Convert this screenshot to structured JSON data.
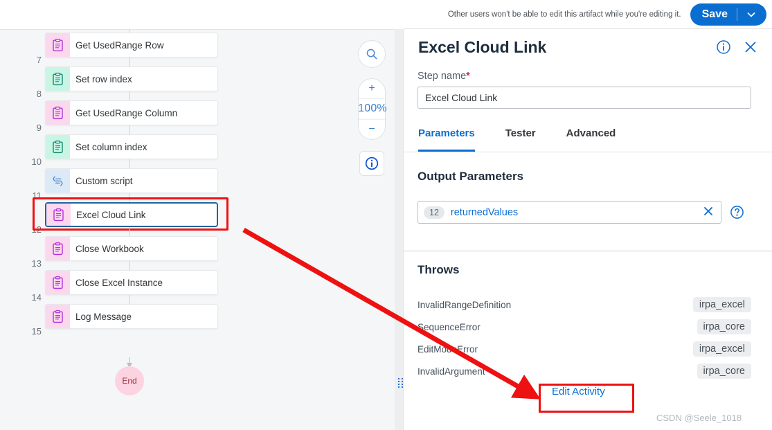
{
  "canvas": {
    "steps": [
      {
        "num": "7",
        "label": "Get UsedRange Row",
        "icon": "clipboard-icon",
        "tint": "pink",
        "selected": false
      },
      {
        "num": "8",
        "label": "Set row index",
        "icon": "clipboard-icon",
        "tint": "mint",
        "selected": false
      },
      {
        "num": "9",
        "label": "Get UsedRange Column",
        "icon": "clipboard-icon",
        "tint": "pink",
        "selected": false
      },
      {
        "num": "10",
        "label": "Set column index",
        "icon": "clipboard-icon",
        "tint": "mint",
        "selected": false
      },
      {
        "num": "11",
        "label": "Custom script",
        "icon": "script-icon",
        "tint": "blue",
        "selected": false
      },
      {
        "num": "12",
        "label": "Excel Cloud Link",
        "icon": "clipboard-icon",
        "tint": "pink",
        "selected": true
      },
      {
        "num": "13",
        "label": "Close Workbook",
        "icon": "clipboard-icon",
        "tint": "pink",
        "selected": false
      },
      {
        "num": "14",
        "label": "Close Excel Instance",
        "icon": "clipboard-icon",
        "tint": "pink",
        "selected": false
      },
      {
        "num": "15",
        "label": "Log Message",
        "icon": "clipboard-icon",
        "tint": "pink",
        "selected": false
      }
    ],
    "end_node_label": "End",
    "controls": {
      "search_icon": "search-icon",
      "zoom_in": "+",
      "zoom_level": "100%",
      "zoom_out": "−",
      "info_icon": "info-icon"
    }
  },
  "panel": {
    "topbar": {
      "edit_note": "Other users won't be able to edit this artifact while you're editing it.",
      "save_label": "Save",
      "save_caret_icon": "chevron-down-icon"
    },
    "title": "Excel Cloud Link",
    "title_info_icon": "info-icon",
    "title_close_icon": "close-icon",
    "step_name_label": "Step name",
    "step_name_required_marker": "*",
    "step_name_value": "Excel Cloud Link",
    "step_name_placeholder": "Step name",
    "tabs": [
      {
        "label": "Parameters",
        "active": true
      },
      {
        "label": "Tester",
        "active": false
      },
      {
        "label": "Advanced",
        "active": false
      }
    ],
    "output_parameters": {
      "section_title": "Output Parameters",
      "index": "12",
      "name": "returnedValues",
      "clear_icon": "close-icon",
      "help_icon": "question-mark-icon"
    },
    "throws": {
      "section_title": "Throws",
      "rows": [
        {
          "name": "InvalidRangeDefinition",
          "package": "irpa_excel"
        },
        {
          "name": "SequenceError",
          "package": "irpa_core"
        },
        {
          "name": "EditModeError",
          "package": "irpa_excel"
        },
        {
          "name": "InvalidArgument",
          "package": "irpa_core"
        }
      ]
    },
    "edit_activity_label": "Edit Activity"
  },
  "annotations": {
    "watermark": "CSDN @Seele_1018",
    "highlight_color": "#ee1111",
    "arrow_color": "#ee1111"
  },
  "colors": {
    "accent": "#0a6ed1",
    "title": "#1d2d3e",
    "canvas_bg": "#f5f6f7",
    "pink_tint": "#fbd8ee",
    "mint_tint": "#c9f5e4",
    "blue_tint": "#dceaf8"
  }
}
